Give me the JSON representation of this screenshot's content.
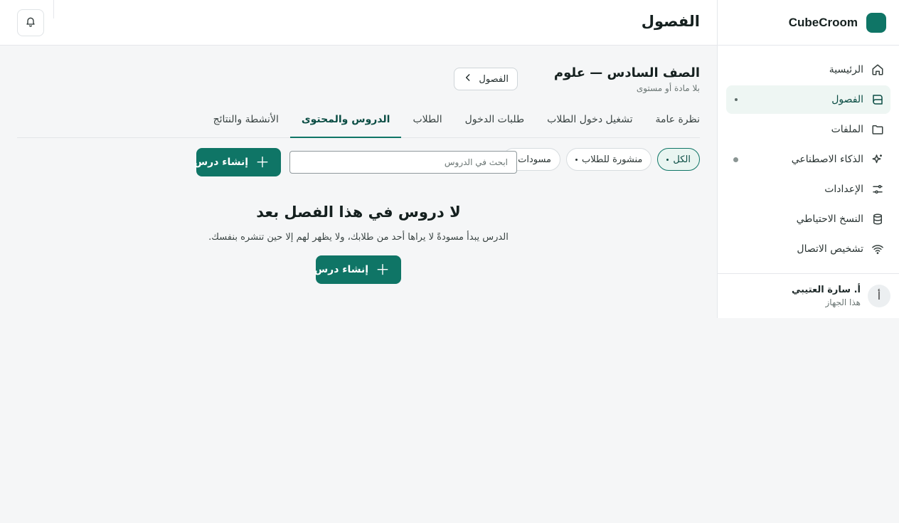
{
  "brand": {
    "name": "CubeCroom",
    "logo_color": "#0f7566"
  },
  "sidebar": {
    "items": [
      {
        "label": "الرئيسية",
        "icon": "home-icon"
      },
      {
        "label": "الفصول",
        "icon": "book-icon",
        "active": true
      },
      {
        "label": "الملفات",
        "icon": "folder-icon"
      },
      {
        "label": "الذكاء الاصطناعي",
        "icon": "sparkles-icon"
      },
      {
        "label": "الإعدادات",
        "icon": "sliders-icon"
      },
      {
        "label": "النسخ الاحتياطي",
        "icon": "database-icon"
      },
      {
        "label": "تشخيص الاتصال",
        "icon": "wifi-icon"
      }
    ]
  },
  "user": {
    "initial": "أ",
    "name": "أ. سارة العتيبي",
    "device": "هذا الجهاز"
  },
  "header": {
    "title": "الفصول"
  },
  "class": {
    "title": "الصف السادس — علوم",
    "subtitle": "بلا مادة أو مستوى",
    "back_label": "الفصول"
  },
  "tabs": [
    "نظرة عامة",
    "تشغيل دخول الطلاب",
    "طلبات الدخول",
    "الطلاب",
    "الدروس والمحتوى",
    "الأنشطة والنتائج"
  ],
  "active_tab": "الدروس والمحتوى",
  "filters": [
    "الكل",
    "منشورة للطلاب",
    "مسودات"
  ],
  "search": {
    "placeholder": "ابحث في الدروس",
    "value": ""
  },
  "create_label": "إنشاء درس",
  "empty": {
    "title": "لا دروس في هذا الفصل بعد",
    "description": "الدرس يبدأ مسودةً لا يراها أحد من طلابك، ولا يظهر لهم إلا حين تنشره بنفسك."
  },
  "colors": {
    "accent": "#0f7566",
    "active_bg": "#eef6f3"
  }
}
